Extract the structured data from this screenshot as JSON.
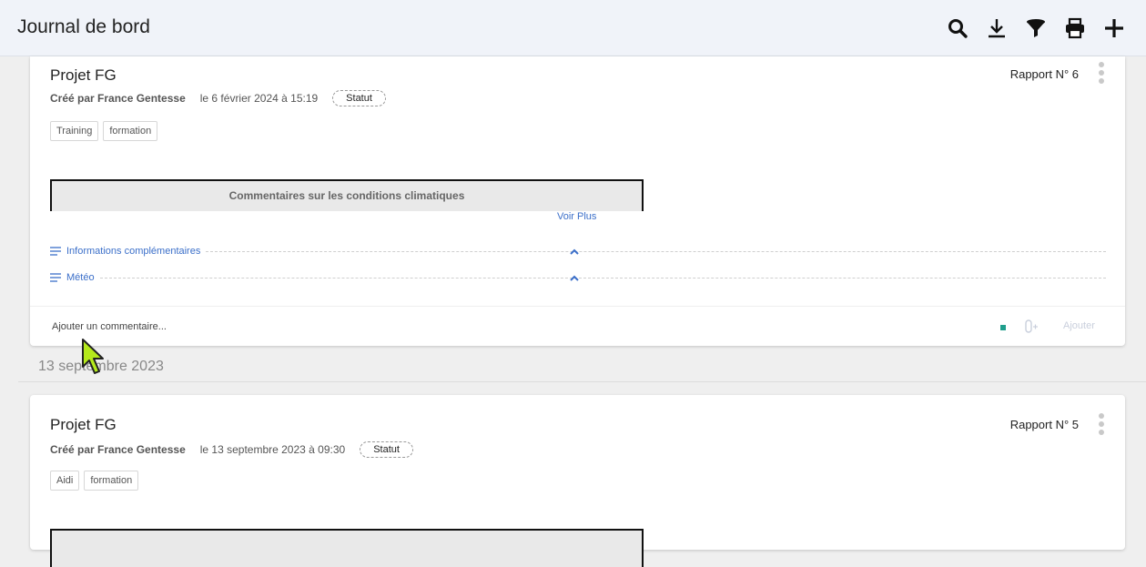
{
  "header": {
    "title": "Journal de bord",
    "icons": [
      "search-icon",
      "download-icon",
      "filter-icon",
      "print-icon",
      "add-icon"
    ]
  },
  "reports": [
    {
      "project": "Projet FG",
      "report_number": "Rapport N° 6",
      "author": "Créé par France Gentesse",
      "date": "le 6 février 2024 à 15:19",
      "status": "Statut",
      "tags": [
        "Training",
        "formation"
      ],
      "table_header": "Commentaires sur les conditions climatiques",
      "voir_plus": "Voir Plus",
      "sections": [
        "Informations complémentaires",
        "Météo"
      ],
      "comment_placeholder": "Ajouter un commentaire...",
      "add_label": "Ajouter"
    },
    {
      "project": "Projet FG",
      "report_number": "Rapport N° 5",
      "author": "Créé par France Gentesse",
      "date": "le 13 septembre 2023 à 09:30",
      "status": "Statut",
      "tags": [
        "Aidi",
        "formation"
      ]
    }
  ],
  "date_separator": "13 septembre 2023",
  "colors": {
    "accent_link": "#3b6fc9",
    "teal_indicator": "#1f9e8c",
    "header_bg": "#f0f3f9",
    "cursor": "#b5ea1c"
  }
}
